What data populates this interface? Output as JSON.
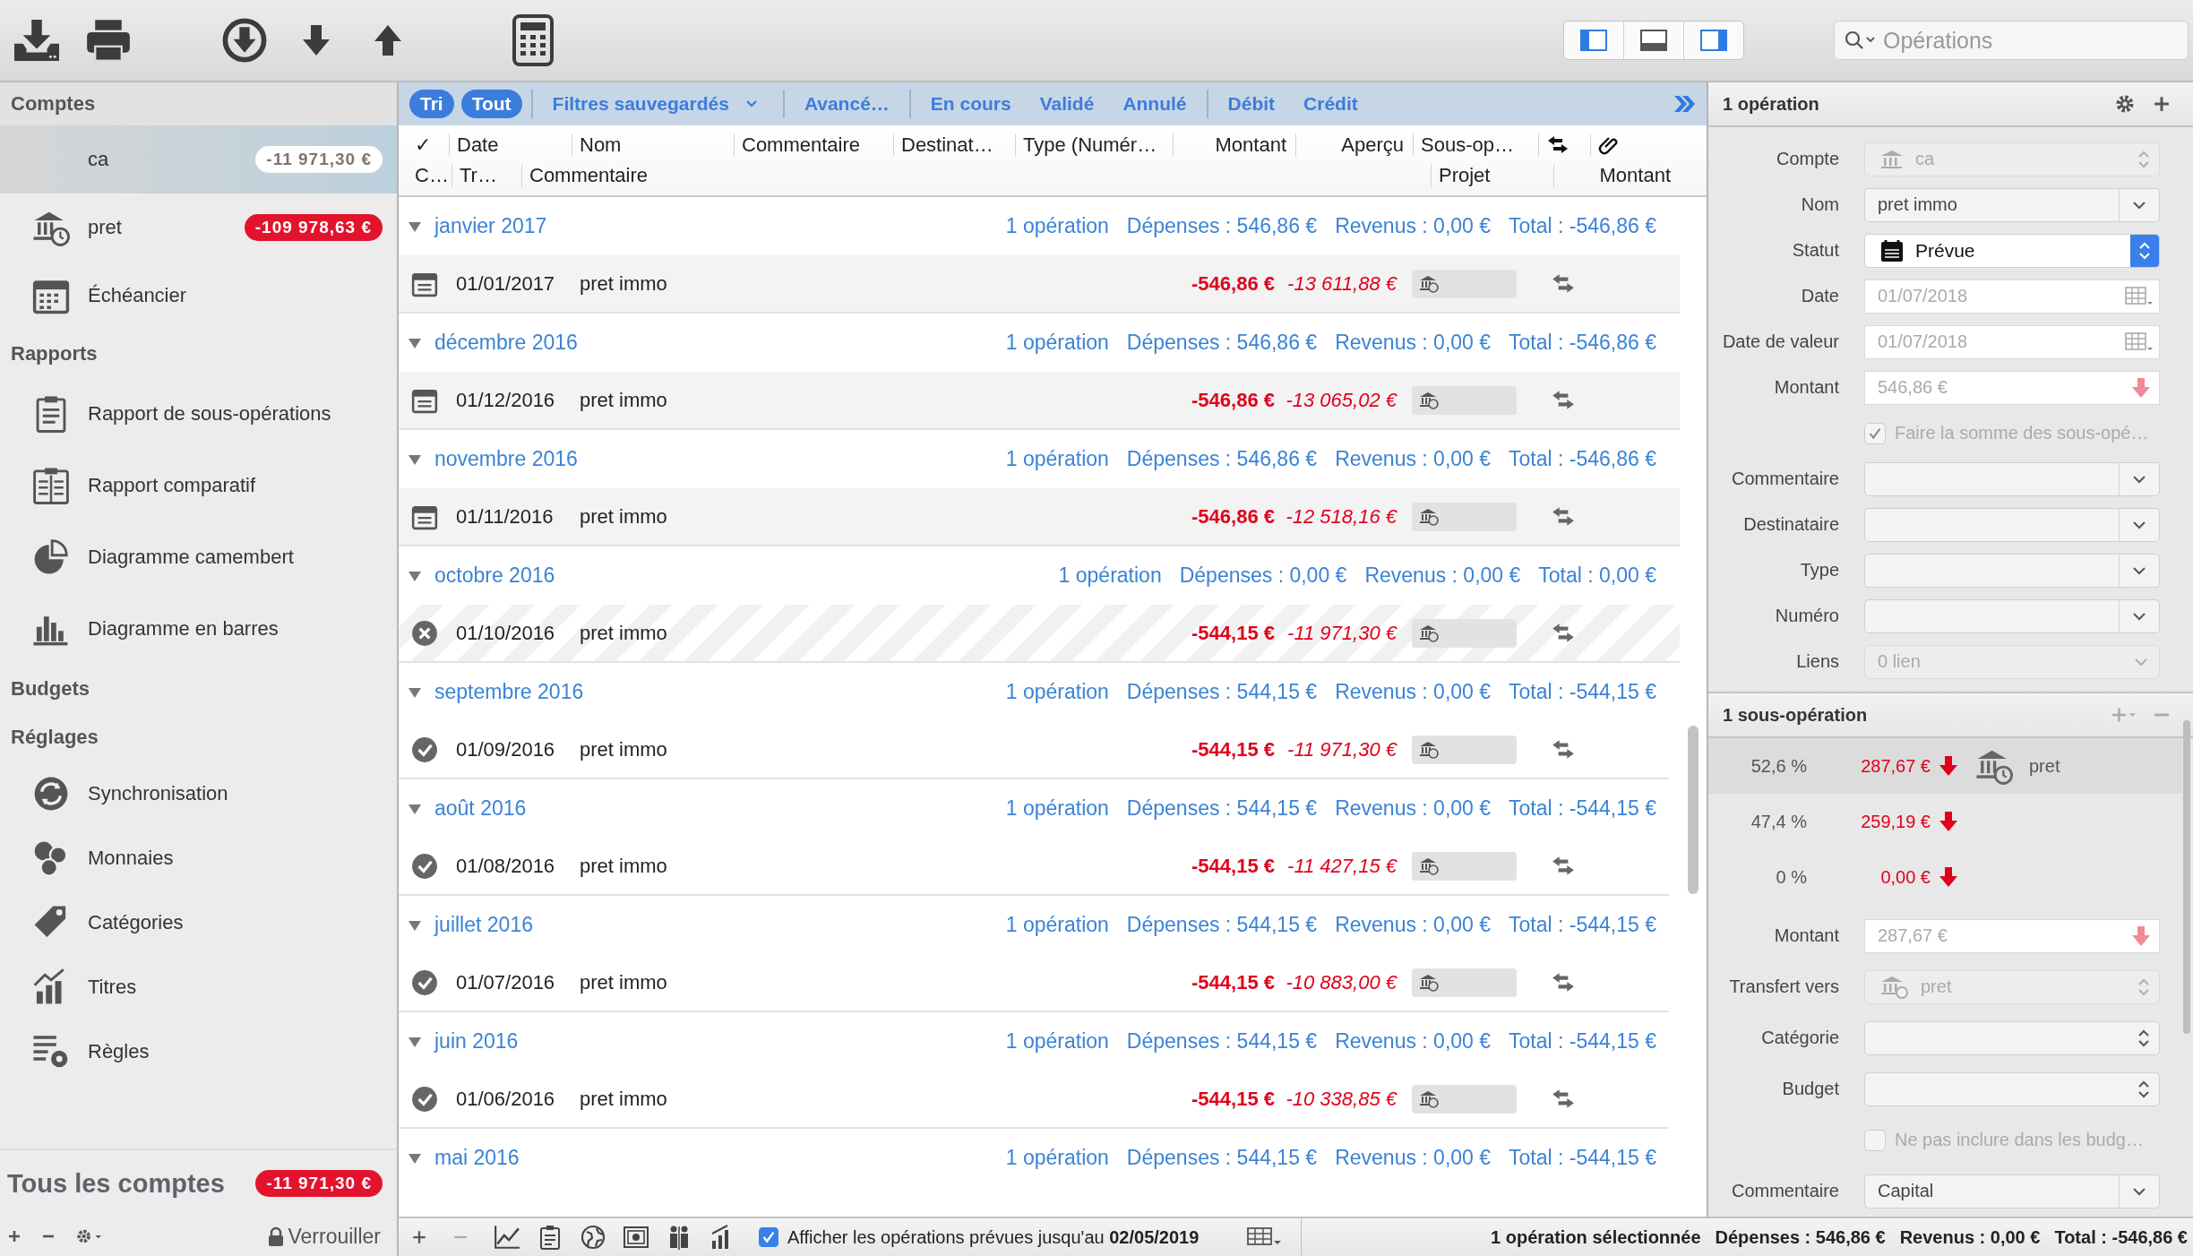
{
  "toolbar": {
    "view_toggles": [
      {
        "selected": true
      },
      {
        "selected": false
      },
      {
        "selected": true
      }
    ],
    "search": {
      "placeholder": "Opérations"
    }
  },
  "sidebar": {
    "sections": [
      {
        "title": "Comptes",
        "items": [
          {
            "label": "ca",
            "badge": "-11 971,30 €",
            "selected": true
          },
          {
            "label": "pret",
            "badge": "-109 978,63 €",
            "selected": false
          },
          {
            "label": "Échéancier",
            "selected": false
          }
        ]
      },
      {
        "title": "Rapports",
        "items": [
          {
            "label": "Rapport de sous-opérations",
            "selected": false
          },
          {
            "label": "Rapport comparatif",
            "selected": false
          },
          {
            "label": "Diagramme camembert",
            "selected": false
          },
          {
            "label": "Diagramme en barres",
            "selected": false
          }
        ]
      },
      {
        "title": "Budgets"
      },
      {
        "title": "Réglages",
        "items": [
          {
            "label": "Synchronisation",
            "selected": false
          },
          {
            "label": "Monnaies",
            "selected": false
          },
          {
            "label": "Catégories",
            "selected": false
          },
          {
            "label": "Titres",
            "selected": false
          },
          {
            "label": "Règles",
            "selected": false
          }
        ]
      }
    ],
    "total": {
      "label": "Tous les comptes",
      "badge": "-11 971,30 €"
    },
    "lock_label": "Verrouiller"
  },
  "filter_bar": [
    {
      "label": "Tri",
      "selected": true,
      "kind": "pill"
    },
    {
      "label": "Tout",
      "selected": true,
      "kind": "pill"
    },
    {
      "label": "Filtres sauvegardés",
      "selected": false,
      "kind": "menu"
    },
    {
      "label": "Avancé…",
      "selected": false,
      "kind": "text"
    },
    {
      "label": "En cours",
      "selected": false,
      "kind": "text"
    },
    {
      "label": "Validé",
      "selected": false,
      "kind": "text"
    },
    {
      "label": "Annulé",
      "selected": false,
      "kind": "text"
    },
    {
      "label": "Débit",
      "selected": false,
      "kind": "text"
    },
    {
      "label": "Crédit",
      "selected": false,
      "kind": "text"
    }
  ],
  "columns_row1": [
    "✓",
    "Date",
    "Nom",
    "Commentaire",
    "Destinat…",
    "Type (Numér…",
    "Montant",
    "Aperçu",
    "Sous-op…"
  ],
  "columns_row2": [
    "C…",
    "Tr…",
    "Commentaire",
    "Projet",
    "Montant"
  ],
  "groups": [
    {
      "month": "janvier 2017",
      "count": "1 opération",
      "expenses": "Dépenses : 546,86 €",
      "income": "Revenus : 0,00 €",
      "total": "Total : -546,86 €",
      "expanded": true,
      "operations": [
        {
          "kind": "scheduled",
          "date": "01/01/2017",
          "name": "pret immo",
          "amount": "-546,86 €",
          "balance": "-13 611,88 €"
        }
      ]
    },
    {
      "month": "décembre 2016",
      "count": "1 opération",
      "expenses": "Dépenses : 546,86 €",
      "income": "Revenus : 0,00 €",
      "total": "Total : -546,86 €",
      "expanded": true,
      "operations": [
        {
          "kind": "scheduled",
          "date": "01/12/2016",
          "name": "pret immo",
          "amount": "-546,86 €",
          "balance": "-13 065,02 €"
        }
      ]
    },
    {
      "month": "novembre 2016",
      "count": "1 opération",
      "expenses": "Dépenses : 546,86 €",
      "income": "Revenus : 0,00 €",
      "total": "Total : -546,86 €",
      "expanded": true,
      "operations": [
        {
          "kind": "scheduled",
          "date": "01/11/2016",
          "name": "pret immo",
          "amount": "-546,86 €",
          "balance": "-12 518,16 €"
        }
      ]
    },
    {
      "month": "octobre 2016",
      "count": "1 opération",
      "expenses": "Dépenses : 0,00 €",
      "income": "Revenus : 0,00 €",
      "total": "Total : 0,00 €",
      "expanded": true,
      "operations": [
        {
          "kind": "cancelled",
          "date": "01/10/2016",
          "name": "pret immo",
          "amount": "-544,15 €",
          "balance": "-11 971,30 €"
        }
      ]
    },
    {
      "month": "septembre 2016",
      "count": "1 opération",
      "expenses": "Dépenses : 544,15 €",
      "income": "Revenus : 0,00 €",
      "total": "Total : -544,15 €",
      "expanded": true,
      "operations": [
        {
          "kind": "validated",
          "date": "01/09/2016",
          "name": "pret immo",
          "amount": "-544,15 €",
          "balance": "-11 971,30 €"
        }
      ]
    },
    {
      "month": "août 2016",
      "count": "1 opération",
      "expenses": "Dépenses : 544,15 €",
      "income": "Revenus : 0,00 €",
      "total": "Total : -544,15 €",
      "expanded": true,
      "operations": [
        {
          "kind": "validated",
          "date": "01/08/2016",
          "name": "pret immo",
          "amount": "-544,15 €",
          "balance": "-11 427,15 €"
        }
      ]
    },
    {
      "month": "juillet 2016",
      "count": "1 opération",
      "expenses": "Dépenses : 544,15 €",
      "income": "Revenus : 0,00 €",
      "total": "Total : -544,15 €",
      "expanded": true,
      "operations": [
        {
          "kind": "validated",
          "date": "01/07/2016",
          "name": "pret immo",
          "amount": "-544,15 €",
          "balance": "-10 883,00 €"
        }
      ]
    },
    {
      "month": "juin 2016",
      "count": "1 opération",
      "expenses": "Dépenses : 544,15 €",
      "income": "Revenus : 0,00 €",
      "total": "Total : -544,15 €",
      "expanded": true,
      "operations": [
        {
          "kind": "validated",
          "date": "01/06/2016",
          "name": "pret immo",
          "amount": "-544,15 €",
          "balance": "-10 338,85 €"
        }
      ]
    },
    {
      "month": "mai 2016",
      "count": "1 opération",
      "expenses": "Dépenses : 544,15 €",
      "income": "Revenus : 0,00 €",
      "total": "Total : -544,15 €",
      "expanded": true
    }
  ],
  "inspector": {
    "title": "1 opération",
    "fields": [
      {
        "kind": "account",
        "label": "Compte",
        "value": "ca",
        "disabled": true
      },
      {
        "kind": "combo",
        "label": "Nom",
        "value": "pret immo",
        "disabled": false
      },
      {
        "kind": "status",
        "label": "Statut",
        "value": "Prévue",
        "disabled": false
      },
      {
        "kind": "date",
        "label": "Date",
        "value": "01/07/2018",
        "disabled": true
      },
      {
        "kind": "date",
        "label": "Date de valeur",
        "value": "01/07/2018",
        "disabled": true
      },
      {
        "kind": "amount",
        "label": "Montant",
        "value": "546,86 €",
        "disabled": true
      },
      {
        "kind": "checkbox",
        "text": "Faire la somme des sous-opé…",
        "checked": true,
        "disabled": true
      },
      {
        "kind": "combo",
        "label": "Commentaire",
        "disabled": false
      },
      {
        "kind": "combo",
        "label": "Destinataire",
        "disabled": false
      },
      {
        "kind": "combo",
        "label": "Type",
        "disabled": false
      },
      {
        "kind": "combo",
        "label": "Numéro",
        "disabled": false
      },
      {
        "kind": "menu",
        "label": "Liens",
        "value": "0 lien",
        "disabled": true
      }
    ]
  },
  "sub_operations": {
    "title": "1 sous-opération",
    "rows": [
      {
        "percent": "52,6 %",
        "amount": "287,67 €",
        "account": "pret",
        "selected": true
      },
      {
        "percent": "47,4 %",
        "amount": "259,19 €",
        "selected": false
      },
      {
        "percent": "0 %",
        "amount": "0,00 €",
        "selected": false
      }
    ],
    "fields": [
      {
        "kind": "amount",
        "label": "Montant",
        "value": "287,67 €",
        "disabled": true
      },
      {
        "kind": "account",
        "label": "Transfert vers",
        "value": "pret",
        "disabled": true
      },
      {
        "kind": "popup",
        "label": "Catégorie",
        "disabled": false
      },
      {
        "kind": "popup",
        "label": "Budget",
        "disabled": false
      },
      {
        "kind": "checkbox",
        "text": "Ne pas inclure dans les budg…",
        "checked": false,
        "disabled": true
      },
      {
        "kind": "combo",
        "label": "Commentaire",
        "value": "Capital",
        "disabled": false
      }
    ]
  },
  "bottom_bar": {
    "show_scheduled": {
      "checked": true,
      "label": "Afficher les opérations prévues jusqu'au **02/05/2019**"
    },
    "status": [
      "1 opération sélectionnée",
      "Dépenses : 546,86 €",
      "Revenus : 0,00 €",
      "Total : -546,86 €"
    ]
  }
}
